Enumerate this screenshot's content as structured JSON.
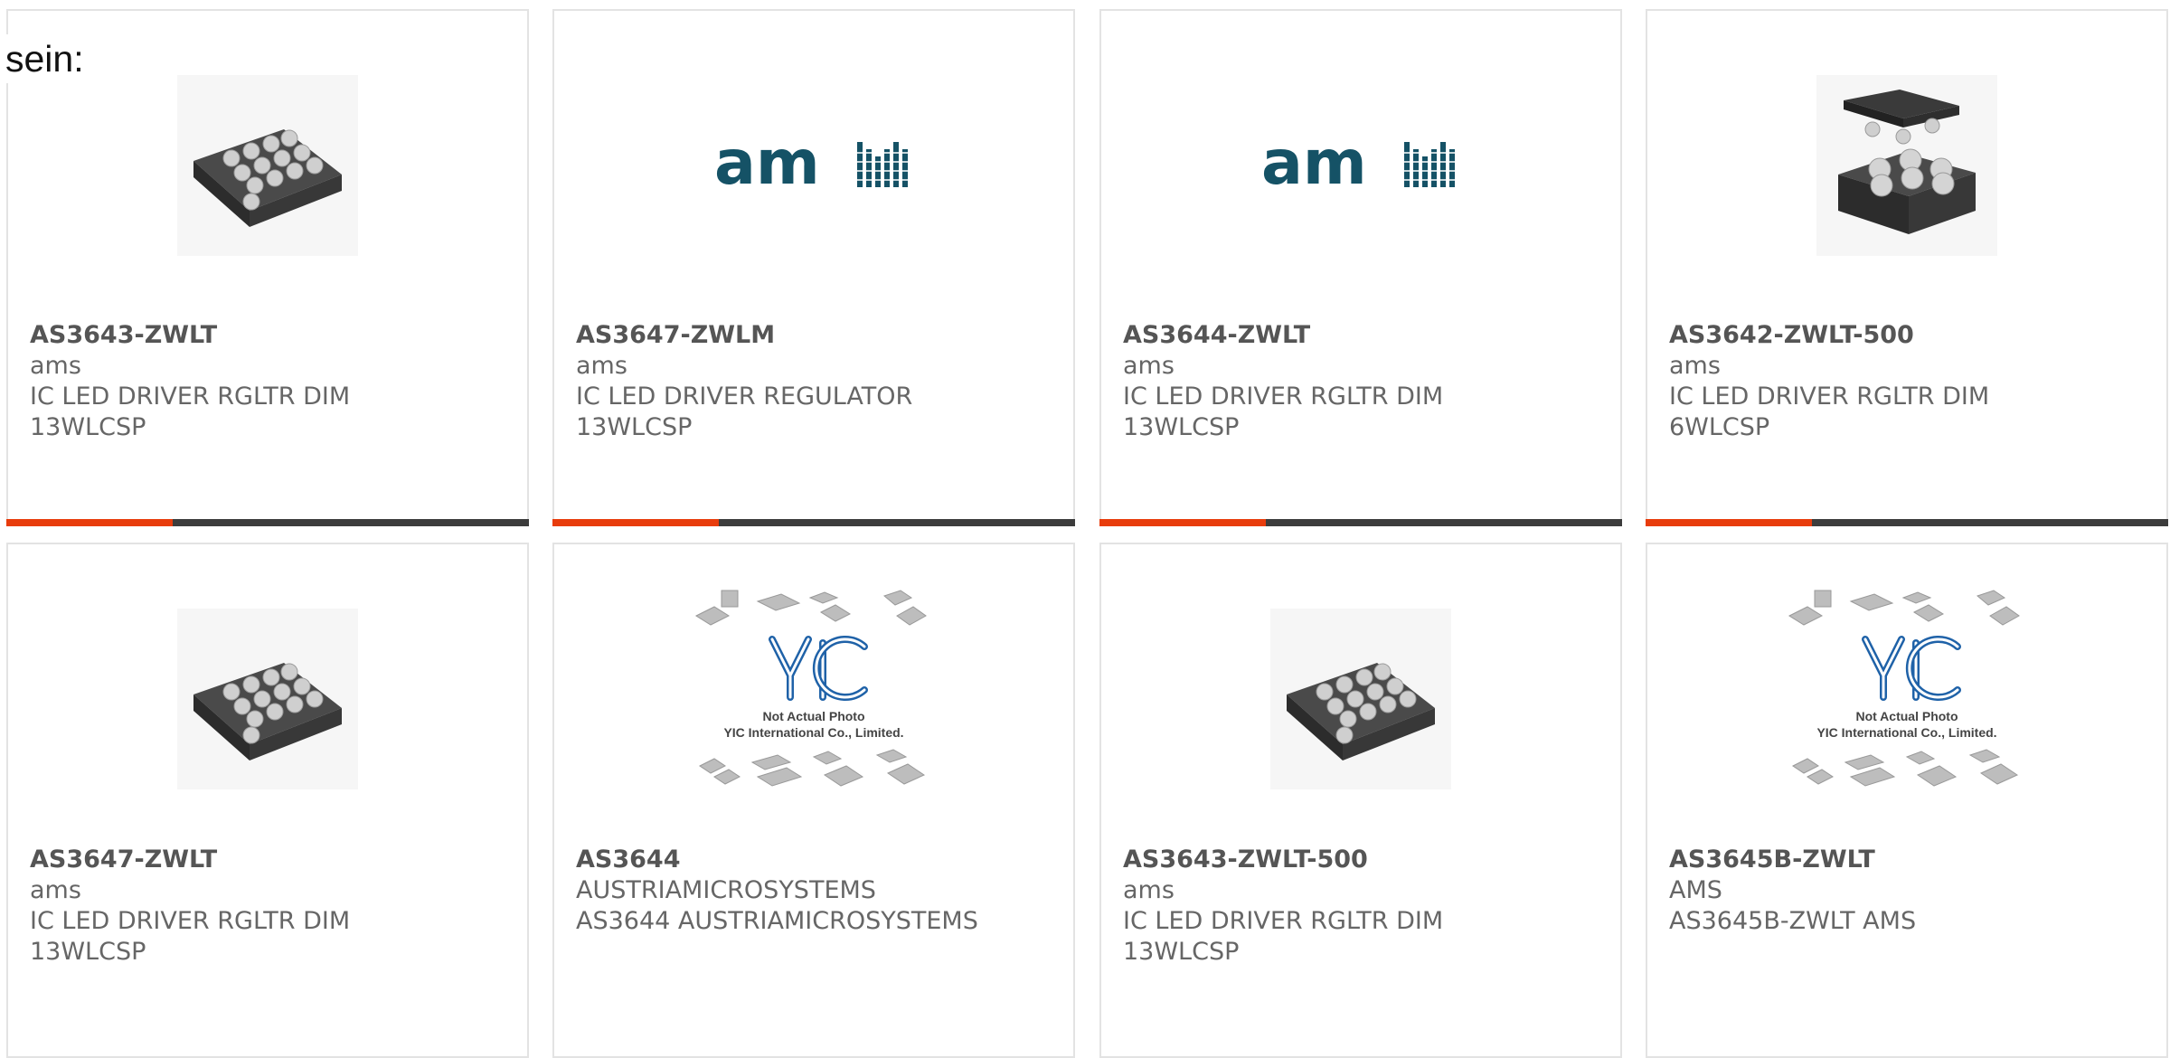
{
  "intro_text": "sein:",
  "colors": {
    "accent": "#e83c0c",
    "bar": "#3c3c3c",
    "border": "#e3e3e3",
    "text": "#666666",
    "ams_logo": "#155266"
  },
  "products": [
    {
      "part": "AS3643-ZWLT",
      "maker": "ams",
      "desc_line1": "IC LED DRIVER RGLTR DIM",
      "desc_line2": "13WLCSP",
      "image": "chip-13ball-icon"
    },
    {
      "part": "AS3647-ZWLM",
      "maker": "ams",
      "desc_line1": "IC LED DRIVER REGULATOR",
      "desc_line2": "13WLCSP",
      "image": "ams-logo",
      "logo_text": "am"
    },
    {
      "part": "AS3644-ZWLT",
      "maker": "ams",
      "desc_line1": "IC LED DRIVER RGLTR DIM",
      "desc_line2": "13WLCSP",
      "image": "ams-logo",
      "logo_text": "am"
    },
    {
      "part": "AS3642-ZWLT-500",
      "maker": "ams",
      "desc_line1": "IC LED DRIVER RGLTR DIM",
      "desc_line2": "6WLCSP",
      "image": "chip-6ball-icon"
    },
    {
      "part": "AS3647-ZWLT",
      "maker": "ams",
      "desc_line1": "IC LED DRIVER RGLTR DIM",
      "desc_line2": "13WLCSP",
      "image": "chip-13ball-icon"
    },
    {
      "part": "AS3644",
      "maker": "AUSTRIAMICROSYSTEMS",
      "desc_line1": "AS3644 AUSTRIAMICROSYSTEMS",
      "desc_line2": "",
      "image": "yic-placeholder",
      "ph_line1": "Not Actual Photo",
      "ph_line2": "YIC International Co., Limited."
    },
    {
      "part": "AS3643-ZWLT-500",
      "maker": "ams",
      "desc_line1": "IC LED DRIVER RGLTR DIM",
      "desc_line2": "13WLCSP",
      "image": "chip-13ball-icon"
    },
    {
      "part": "AS3645B-ZWLT",
      "maker": "AMS",
      "desc_line1": "AS3645B-ZWLT AMS",
      "desc_line2": "",
      "image": "yic-placeholder",
      "ph_line1": "Not Actual Photo",
      "ph_line2": "YIC International Co., Limited."
    }
  ]
}
